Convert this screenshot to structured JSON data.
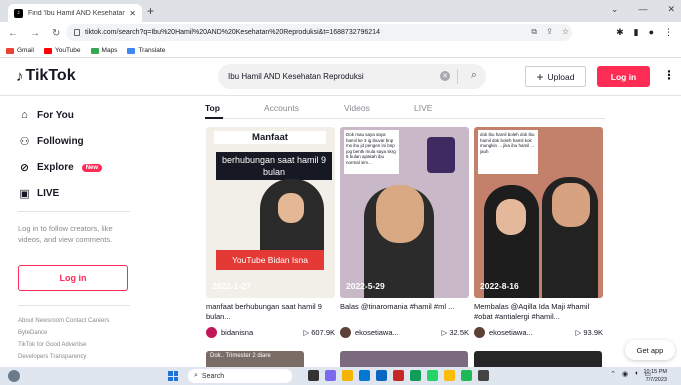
{
  "browser": {
    "tab_title": "Find 'Ibu Hamil AND Kesehatan R",
    "url": "tiktok.com/search?q=Ibu%20Hamil%20AND%20Kesehatan%20Reproduksi&t=1688732796214",
    "bookmarks": [
      "Gmail",
      "YouTube",
      "Maps",
      "Translate"
    ]
  },
  "header": {
    "logo": "TikTok",
    "search_value": "Ibu Hamil AND Kesehatan Reproduksi",
    "upload_label": "Upload",
    "login_label": "Log in"
  },
  "sidebar": {
    "items": [
      {
        "label": "For You"
      },
      {
        "label": "Following"
      },
      {
        "label": "Explore",
        "badge": "New"
      },
      {
        "label": "LIVE"
      }
    ],
    "login_prompt": "Log in to follow creators, like videos, and view comments.",
    "login_button": "Log in",
    "footer_line1": "About  Newsroom  Contact  Careers",
    "footer_line2": "ByteDance",
    "footer_line3": "TikTok for Good  Advertise",
    "footer_line4": "Developers  Transparency"
  },
  "tabs": [
    "Top",
    "Accounts",
    "Videos",
    "LIVE"
  ],
  "videos": [
    {
      "caption_top": "Manfaat",
      "caption_mid": "berhubungan saat hamil 9 bulan",
      "banner": "YouTube Bidan Isna",
      "date": "2022-1-27",
      "desc": "manfaat berhubungan saat hamil 9 bulan...",
      "user": "bidanisna",
      "views": "607.9K"
    },
    {
      "note": "Dok mau saya saya hamil ke 3 ig ibuvaI bnp ms ibu jd pengen ini bnp jog bentk mula saya skrg 6 bulan apakah ibu normal sim...",
      "date": "2022-5-29",
      "desc": "Balas @tinaromania #hamil #ml ...",
      "user": "ekosetiawa...",
      "views": "32.5K"
    },
    {
      "note": "dok ibu hamil boleh dok ibu hamil dok boleh hamil kok mungkin ... jika ibu hamil ... jauh",
      "date": "2022-8-16",
      "desc": "Membalas @Aqilla Ida Maji #hamil #obat #antialergi #hamil...",
      "user": "ekosetiawa...",
      "views": "93.9K"
    }
  ],
  "peek_label": "Dok.. Trimester 2 diare",
  "get_app": "Get app",
  "taskbar": {
    "search": "Search",
    "time": "10:15 PM",
    "date": "7/7/2023"
  }
}
